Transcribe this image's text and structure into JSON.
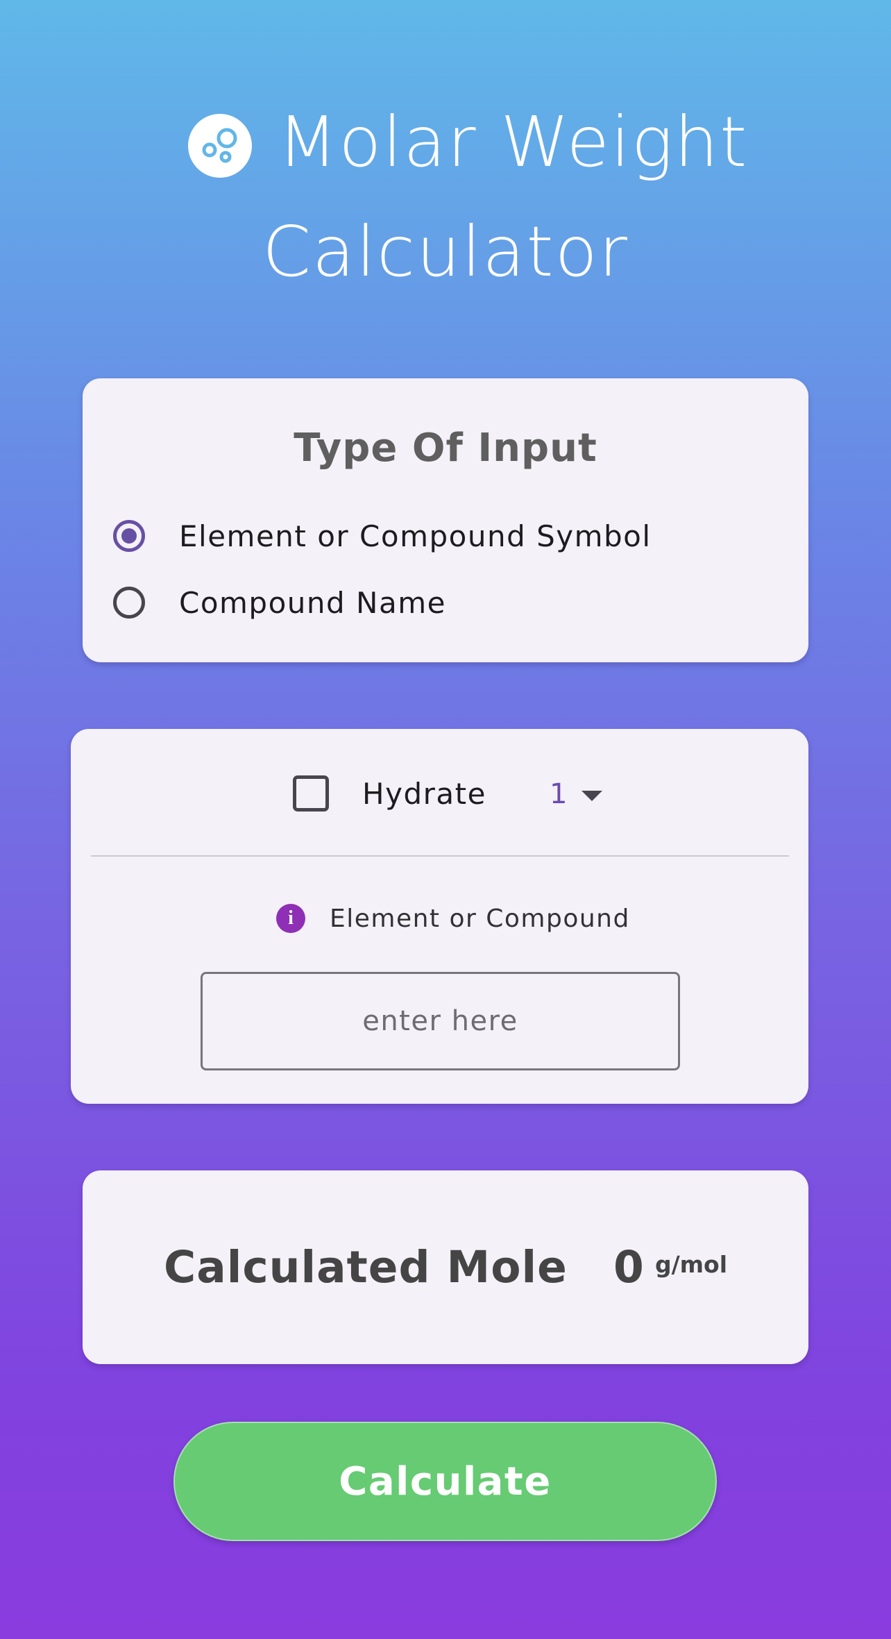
{
  "header": {
    "logo_icon": "bubbles-icon",
    "title_line1": "Molar Weight",
    "title_line2": "Calculator"
  },
  "input_type": {
    "title": "Type Of Input",
    "options": [
      {
        "label": "Element or Compound Symbol",
        "selected": true
      },
      {
        "label": "Compound Name",
        "selected": false
      }
    ]
  },
  "compound": {
    "hydrate_label": "Hydrate",
    "hydrate_checked": false,
    "hydrate_count": "1",
    "info_icon": "info-icon",
    "field_label": "Element or Compound",
    "input_value": "",
    "input_placeholder": "enter here"
  },
  "result": {
    "label": "Calculated Mole",
    "value": "0",
    "unit": "g/mol"
  },
  "actions": {
    "calculate_label": "Calculate"
  },
  "colors": {
    "gradient_top": "#60b8e8",
    "gradient_bottom": "#8a3cdf",
    "card": "#f4f1f8",
    "radio_selected": "#6750a4",
    "info_icon": "#8e2fb5",
    "button": "#66cb73"
  }
}
